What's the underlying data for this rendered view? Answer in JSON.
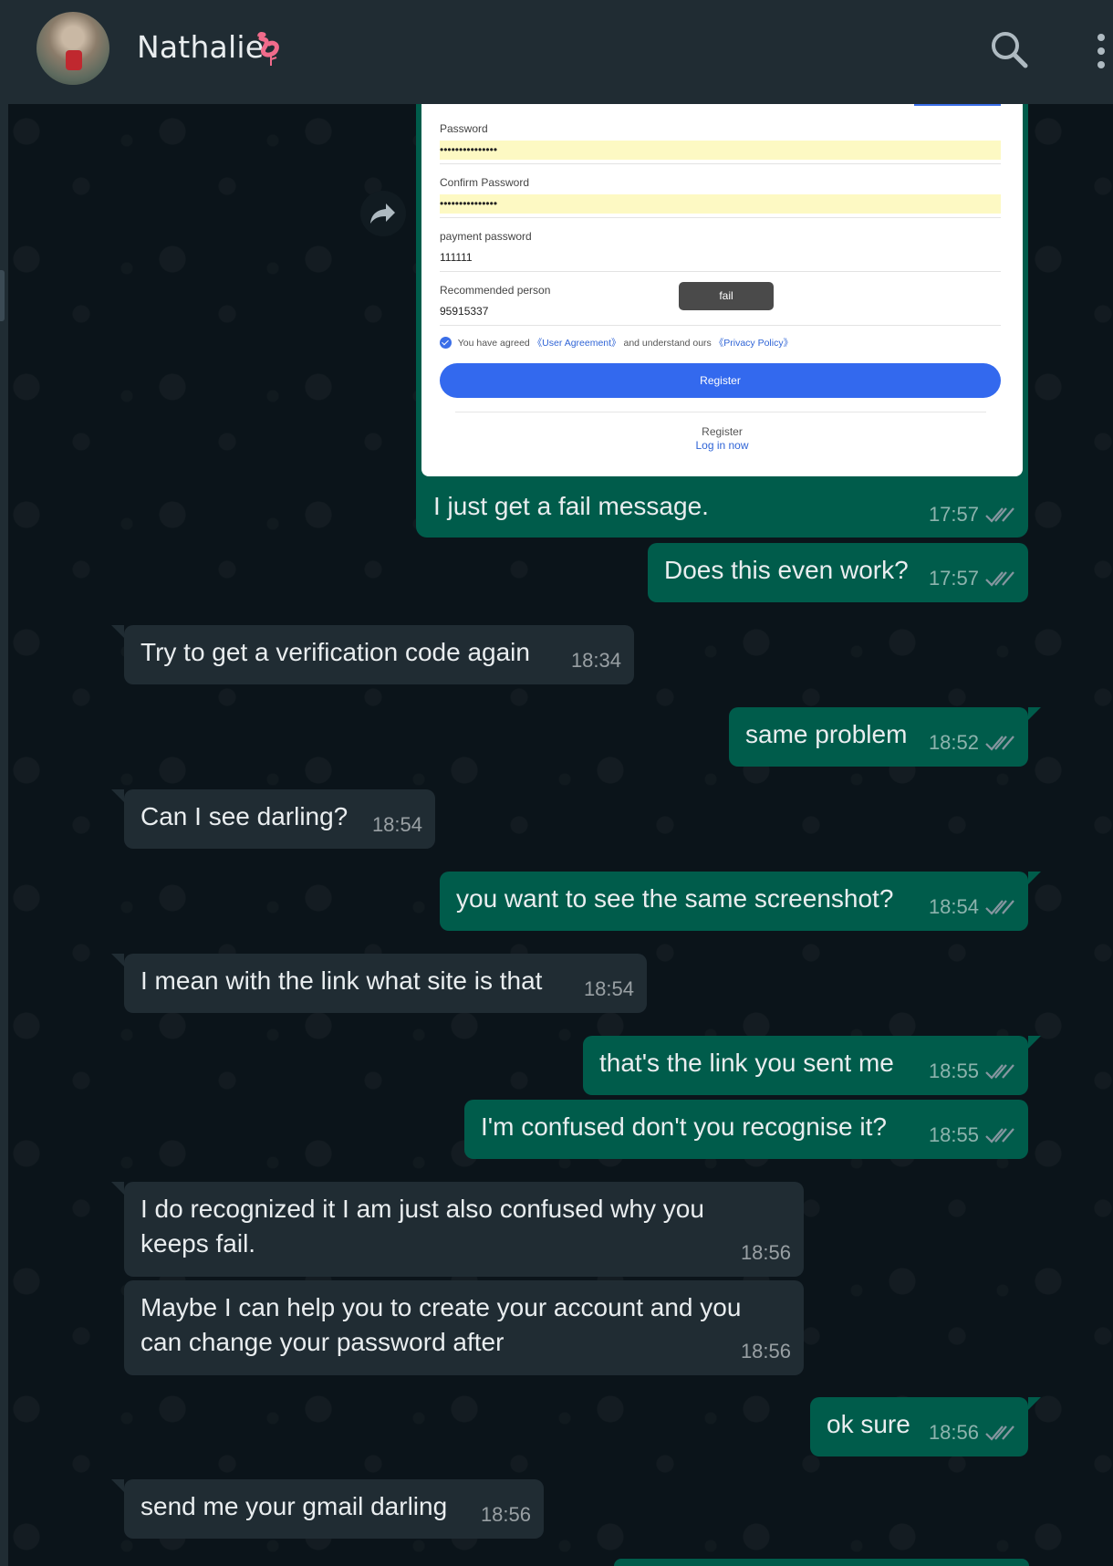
{
  "header": {
    "contact_name": "Nathalie",
    "contact_emoji": "flamingo-icon",
    "icons": [
      "search-icon",
      "more-vertical-icon"
    ]
  },
  "screenshot": {
    "password_label": "Password",
    "password_value": "•••••••••••••••",
    "confirm_label": "Confirm Password",
    "confirm_value": "•••••••••••••••",
    "payment_label": "payment password",
    "payment_value": "111111",
    "recommended_label": "Recommended person",
    "recommended_value": "95915337",
    "fail_label": "fail",
    "agree_prefix": "You have agreed",
    "user_agreement": "《User Agreement》",
    "agree_middle": "and understand ours",
    "privacy_policy": "《Privacy Policy》",
    "register_button": "Register",
    "register_text": "Register",
    "login_link": "Log in now"
  },
  "messages": [
    {
      "dir": "out",
      "text": "I just get a fail message.",
      "time": "17:57"
    },
    {
      "dir": "out",
      "text": "Does this even work?",
      "time": "17:57"
    },
    {
      "dir": "in",
      "text": "Try to get a verification code again",
      "time": "18:34"
    },
    {
      "dir": "out",
      "text": "same problem",
      "time": "18:52"
    },
    {
      "dir": "in",
      "text": "Can I see darling?",
      "time": "18:54"
    },
    {
      "dir": "out",
      "text": "you want to see the same screenshot?",
      "time": "18:54"
    },
    {
      "dir": "in",
      "text": "I mean with the link what site is that",
      "time": "18:54"
    },
    {
      "dir": "out",
      "text": "that's the link you sent me",
      "time": "18:55"
    },
    {
      "dir": "out",
      "text": "I'm confused don't you recognise it?",
      "time": "18:55"
    },
    {
      "dir": "in",
      "text": "I do recognized it I am just also confused why you keeps fail.",
      "time": "18:56"
    },
    {
      "dir": "in",
      "text": "Maybe I can help you to create your account and you can change your password after",
      "time": "18:56"
    },
    {
      "dir": "out",
      "text": "ok sure",
      "time": "18:56"
    },
    {
      "dir": "in",
      "text": "send me your gmail darling",
      "time": "18:56"
    }
  ],
  "colors": {
    "outgoing_bubble": "#005c4b",
    "incoming_bubble": "#202c33",
    "header": "#202c33",
    "background": "#0b141a",
    "read_ticks": "#8696a0"
  }
}
